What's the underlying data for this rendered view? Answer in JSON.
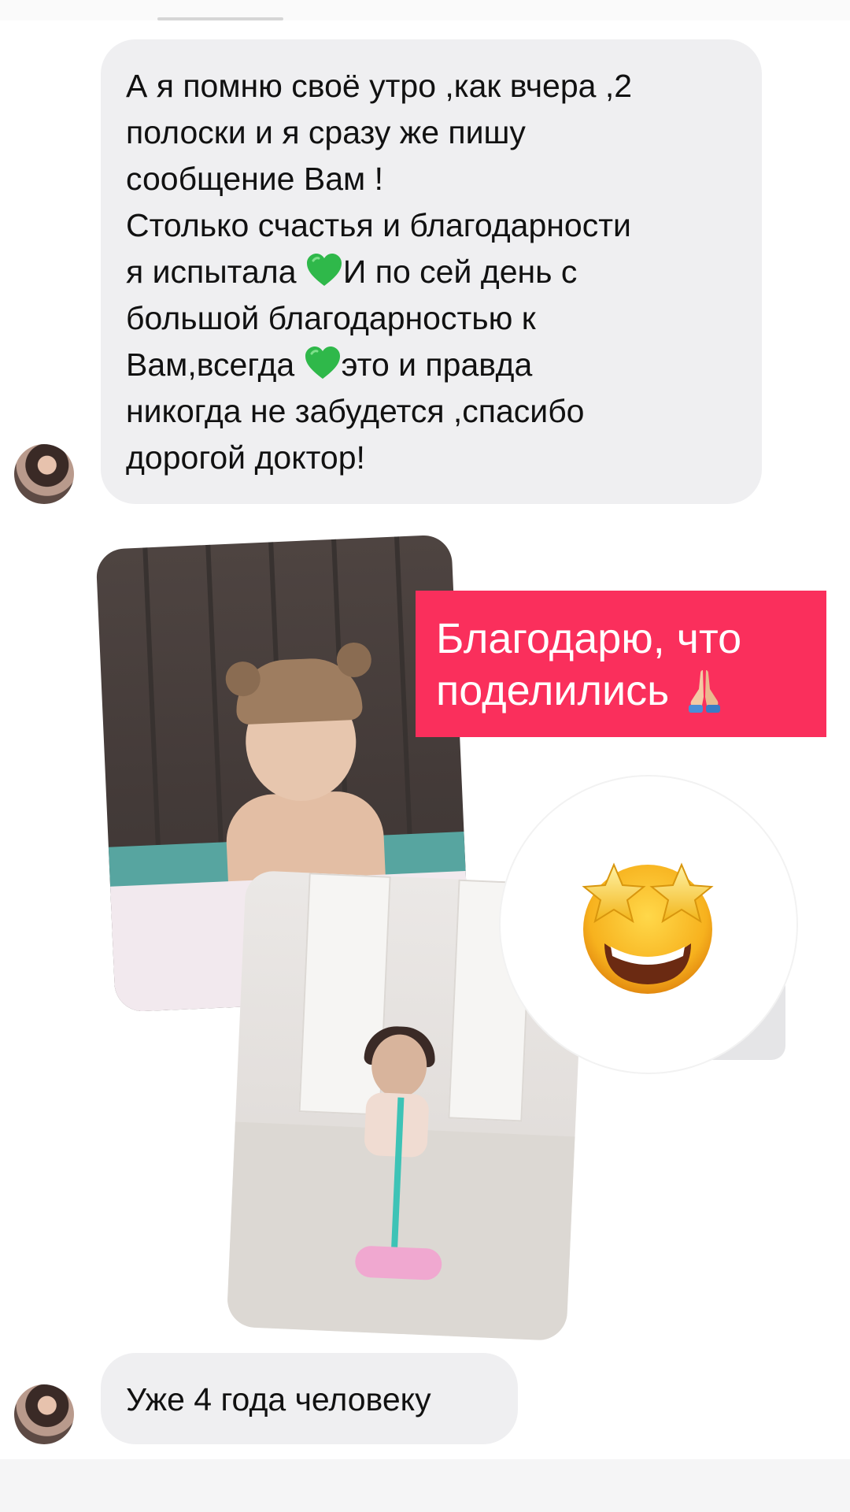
{
  "messages": [
    {
      "sender": "contact",
      "lines": [
        "А я помню своё утро ,как вчера ,2",
        "полоски и я сразу же пишу",
        "сообщение Вам !",
        "Столько счастья и благодарности",
        "я испытала",
        "И по сей день с",
        "большой благодарностью к",
        "Вам,всегда",
        "это и правда",
        "никогда не забудется ,спасибо",
        "дорогой доктор!"
      ],
      "inline_icons": [
        "green-heart-icon",
        "green-heart-icon"
      ]
    },
    {
      "sender": "contact",
      "text": "Уже 4 года человеку"
    }
  ],
  "sticker": {
    "line1": "Благодарю, что",
    "line2": "поделились",
    "icon": "folded-hands-icon",
    "background": "#fa2f5c",
    "text_color": "#ffffff"
  },
  "reaction": {
    "icon": "star-struck-emoji-icon"
  },
  "photos": [
    {
      "subject": "child-in-bear-hat-photo"
    },
    {
      "subject": "child-on-scooter-photo"
    }
  ],
  "colors": {
    "bubble": "#efeff1",
    "accent": "#fa2f5c"
  }
}
